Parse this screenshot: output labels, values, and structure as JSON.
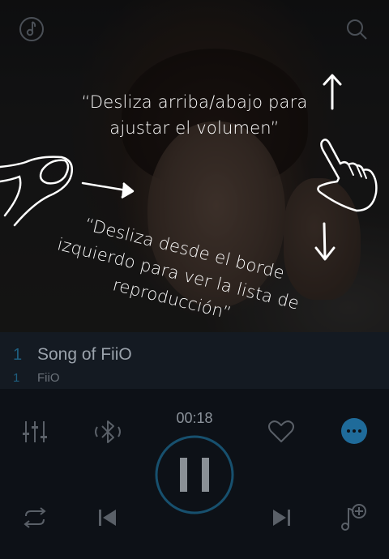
{
  "overlay": {
    "hint_volume_line1": "“Desliza arriba/abajo para",
    "hint_volume_line2": "ajustar el volumen”",
    "hint_playlist_line1": "“Desliza desde el borde",
    "hint_playlist_line2": "izquierdo para ver la lista de",
    "hint_playlist_line3": "reproducción”"
  },
  "track": {
    "index": "1",
    "index_sub": "1",
    "title": "Song of FiiO",
    "artist": "FiiO"
  },
  "player": {
    "elapsed": "00:18"
  },
  "icons": {
    "top_left": "music-note-icon",
    "top_right": "search-icon",
    "equalizer": "equalizer-icon",
    "bluetooth": "bluetooth-icon",
    "favorite": "heart-icon",
    "more": "more-icon",
    "pause": "pause-icon",
    "repeat": "repeat-icon",
    "previous": "previous-icon",
    "next": "next-icon",
    "add_to_playlist": "add-to-playlist-icon"
  },
  "colors": {
    "accent": "#1e6a8f",
    "more_button": "#1f6b9a"
  }
}
